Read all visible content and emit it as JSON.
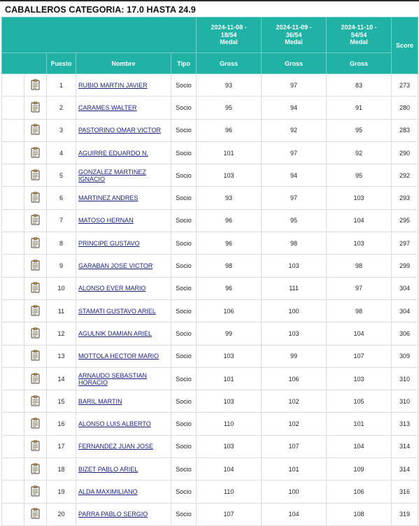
{
  "title": "CABALLEROS CATEGORIA: 17.0 HASTA 24.9",
  "headers": {
    "rounds": [
      {
        "date": "2024-11-08 -",
        "holes": "18/54",
        "type": "Medal",
        "sub": "Gross"
      },
      {
        "date": "2024-11-09 -",
        "holes": "36/54",
        "type": "Medal",
        "sub": "Gross"
      },
      {
        "date": "2024-11-10 -",
        "holes": "54/54",
        "type": "Medal",
        "sub": "Gross"
      }
    ],
    "score": "Score",
    "puesto": "Puesto",
    "nombre": "Nombre",
    "tipo": "Tipo"
  },
  "colors": {
    "header_bg": "#20b2a4",
    "link": "#1a237e"
  },
  "row_icon": "scorecard-clipboard-icon",
  "rows": [
    {
      "pos": "1",
      "name": "RUBIO MARTIN JAVIER",
      "tipo": "Socio",
      "r1": "93",
      "r2": "97",
      "r3": "83",
      "score": "273"
    },
    {
      "pos": "2",
      "name": "CARAMES WALTER",
      "tipo": "Socio",
      "r1": "95",
      "r2": "94",
      "r3": "91",
      "score": "280"
    },
    {
      "pos": "3",
      "name": "PASTORINO OMAR VICTOR",
      "tipo": "Socio",
      "r1": "96",
      "r2": "92",
      "r3": "95",
      "score": "283"
    },
    {
      "pos": "4",
      "name": "AGUIRRE EDUARDO N.",
      "tipo": "Socio",
      "r1": "101",
      "r2": "97",
      "r3": "92",
      "score": "290"
    },
    {
      "pos": "5",
      "name": "GONZALEZ MARTINEZ IGNACIO",
      "tipo": "Socio",
      "r1": "103",
      "r2": "94",
      "r3": "95",
      "score": "292"
    },
    {
      "pos": "6",
      "name": "MARTINEZ ANDRES",
      "tipo": "Socio",
      "r1": "93",
      "r2": "97",
      "r3": "103",
      "score": "293"
    },
    {
      "pos": "7",
      "name": "MATOSO HERNAN",
      "tipo": "Socio",
      "r1": "96",
      "r2": "95",
      "r3": "104",
      "score": "295"
    },
    {
      "pos": "8",
      "name": "PRINCIPE GUSTAVO",
      "tipo": "Socio",
      "r1": "96",
      "r2": "98",
      "r3": "103",
      "score": "297"
    },
    {
      "pos": "9",
      "name": "GARABAN JOSE VICTOR",
      "tipo": "Socio",
      "r1": "98",
      "r2": "103",
      "r3": "98",
      "score": "299"
    },
    {
      "pos": "10",
      "name": "ALONSO EVER MARIO",
      "tipo": "Socio",
      "r1": "96",
      "r2": "111",
      "r3": "97",
      "score": "304"
    },
    {
      "pos": "11",
      "name": "STAMATI GUSTAVO ARIEL",
      "tipo": "Socio",
      "r1": "106",
      "r2": "100",
      "r3": "98",
      "score": "304"
    },
    {
      "pos": "12",
      "name": "AGULNIK DAMIAN ARIEL",
      "tipo": "Socio",
      "r1": "99",
      "r2": "103",
      "r3": "104",
      "score": "306"
    },
    {
      "pos": "13",
      "name": "MOTTOLA HECTOR MARIO",
      "tipo": "Socio",
      "r1": "103",
      "r2": "99",
      "r3": "107",
      "score": "309"
    },
    {
      "pos": "14",
      "name": "ARNAUDO SEBASTIAN HORACIO",
      "tipo": "Socio",
      "r1": "101",
      "r2": "106",
      "r3": "103",
      "score": "310"
    },
    {
      "pos": "15",
      "name": "BARIL MARTIN",
      "tipo": "Socio",
      "r1": "103",
      "r2": "102",
      "r3": "105",
      "score": "310"
    },
    {
      "pos": "16",
      "name": "ALONSO LUIS ALBERTO",
      "tipo": "Socio",
      "r1": "110",
      "r2": "102",
      "r3": "101",
      "score": "313"
    },
    {
      "pos": "17",
      "name": "FERNANDEZ JUAN JOSE",
      "tipo": "Socio",
      "r1": "103",
      "r2": "107",
      "r3": "104",
      "score": "314"
    },
    {
      "pos": "18",
      "name": "BIZET PABLO ARIEL",
      "tipo": "Socio",
      "r1": "104",
      "r2": "101",
      "r3": "109",
      "score": "314"
    },
    {
      "pos": "19",
      "name": "ALDA MAXIMILIANO",
      "tipo": "Socio",
      "r1": "110",
      "r2": "100",
      "r3": "106",
      "score": "316"
    },
    {
      "pos": "20",
      "name": "PARRA PABLO SERGIO",
      "tipo": "Socio",
      "r1": "107",
      "r2": "104",
      "r3": "108",
      "score": "319"
    }
  ]
}
